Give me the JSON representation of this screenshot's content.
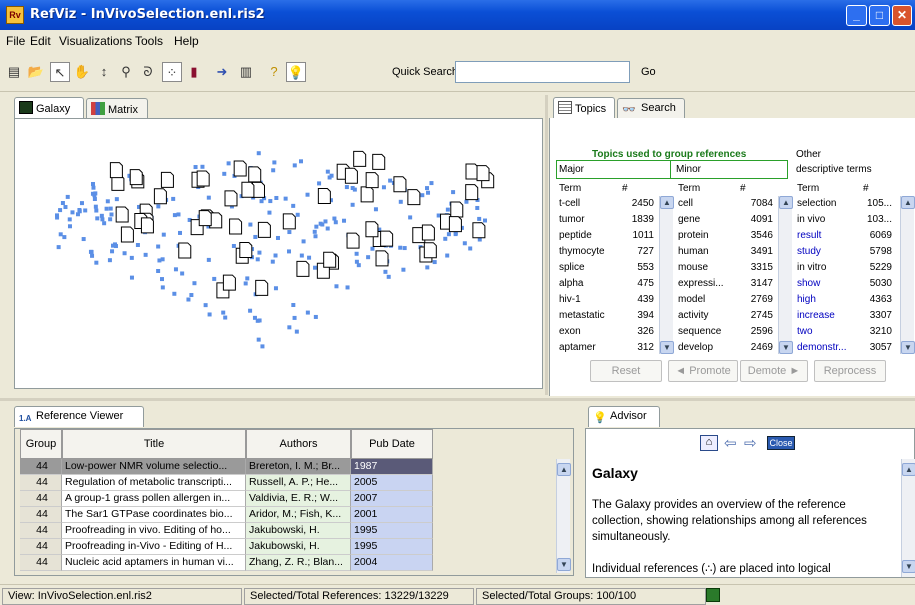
{
  "window": {
    "title": "RefViz - InVivoSelection.enl.ris2",
    "logo": "Rv"
  },
  "menu": [
    "File",
    "Edit",
    "Visualizations",
    "Tools",
    "Help"
  ],
  "toolbar": {
    "icons": [
      "new-icon",
      "open-icon",
      "pointer-icon",
      "hand-icon",
      "updown-icon",
      "zoom-icon",
      "lasso-icon",
      "dots-icon",
      "book-icon",
      "arrow-right-icon",
      "books-icon",
      "help-icon",
      "bulb-icon"
    ],
    "quick_search_label": "Quick Search",
    "quick_search_value": "",
    "go_label": "Go"
  },
  "left_tabs": [
    "Galaxy",
    "Matrix"
  ],
  "right_tabs": [
    "Topics",
    "Search"
  ],
  "topics": {
    "header": "Topics used to group references",
    "other_header_1": "Other",
    "other_header_2": "descriptive terms",
    "major_label": "Major",
    "minor_label": "Minor",
    "col_term": "Term",
    "col_count": "#",
    "major": [
      [
        "t-cell",
        "2450"
      ],
      [
        "tumor",
        "1839"
      ],
      [
        "peptide",
        "1011"
      ],
      [
        "thymocyte",
        "727"
      ],
      [
        "splice",
        "553"
      ],
      [
        "alpha",
        "475"
      ],
      [
        "hiv-1",
        "439"
      ],
      [
        "metastatic",
        "394"
      ],
      [
        "exon",
        "326"
      ],
      [
        "aptamer",
        "312"
      ]
    ],
    "minor": [
      [
        "cell",
        "7084"
      ],
      [
        "gene",
        "4091"
      ],
      [
        "protein",
        "3546"
      ],
      [
        "human",
        "3491"
      ],
      [
        "mouse",
        "3315"
      ],
      [
        "expressi...",
        "3147"
      ],
      [
        "model",
        "2769"
      ],
      [
        "activity",
        "2745"
      ],
      [
        "sequence",
        "2596"
      ],
      [
        "develop",
        "2469"
      ]
    ],
    "other": [
      [
        "selection",
        "105...",
        "#000000"
      ],
      [
        "in vivo",
        "103...",
        "#000000"
      ],
      [
        "result",
        "6069",
        "#0000c0"
      ],
      [
        "study",
        "5798",
        "#0000c0"
      ],
      [
        "in vitro",
        "5229",
        "#000000"
      ],
      [
        "show",
        "5030",
        "#0000c0"
      ],
      [
        "high",
        "4363",
        "#0000c0"
      ],
      [
        "increase",
        "3307",
        "#0000c0"
      ],
      [
        "two",
        "3210",
        "#0000c0"
      ],
      [
        "demonstr...",
        "3057",
        "#0000c0"
      ]
    ],
    "buttons": {
      "reset": "Reset",
      "promote": "Promote",
      "demote": "Demote",
      "reprocess": "Reprocess"
    }
  },
  "reference_viewer": {
    "tab": "Reference Viewer",
    "columns": [
      "Group",
      "Title",
      "Authors",
      "Pub Date"
    ],
    "rows": [
      [
        "44",
        "Low-power NMR volume selectio...",
        "Brereton, I. M.; Br...",
        "1987"
      ],
      [
        "44",
        "Regulation of metabolic transcripti...",
        "Russell, A. P.; He...",
        "2005"
      ],
      [
        "44",
        "A group-1 grass pollen allergen in...",
        "Valdivia, E. R.; W...",
        "2007"
      ],
      [
        "44",
        "The Sar1 GTPase coordinates bio...",
        "Aridor, M.; Fish, K...",
        "2001"
      ],
      [
        "44",
        "Proofreading in vivo. Editing of ho...",
        "Jakubowski, H.",
        "1995"
      ],
      [
        "44",
        "Proofreading in-Vivo - Editing of H...",
        "Jakubowski, H.",
        "1995"
      ],
      [
        "44",
        "Nucleic acid aptamers in human vi...",
        "Zhang, Z. R.; Blan...",
        "2004"
      ]
    ]
  },
  "advisor": {
    "tab": "Advisor",
    "close": "Close",
    "heading": "Galaxy",
    "para1": "The Galaxy provides an overview of the reference collection, showing relationships among all references simultaneously.",
    "para2": "Individual references (∴) are placed into logical"
  },
  "status": {
    "view": "View: InVivoSelection.enl.ris2",
    "refs": "Selected/Total References: 13229/13229",
    "groups": "Selected/Total Groups: 100/100"
  }
}
